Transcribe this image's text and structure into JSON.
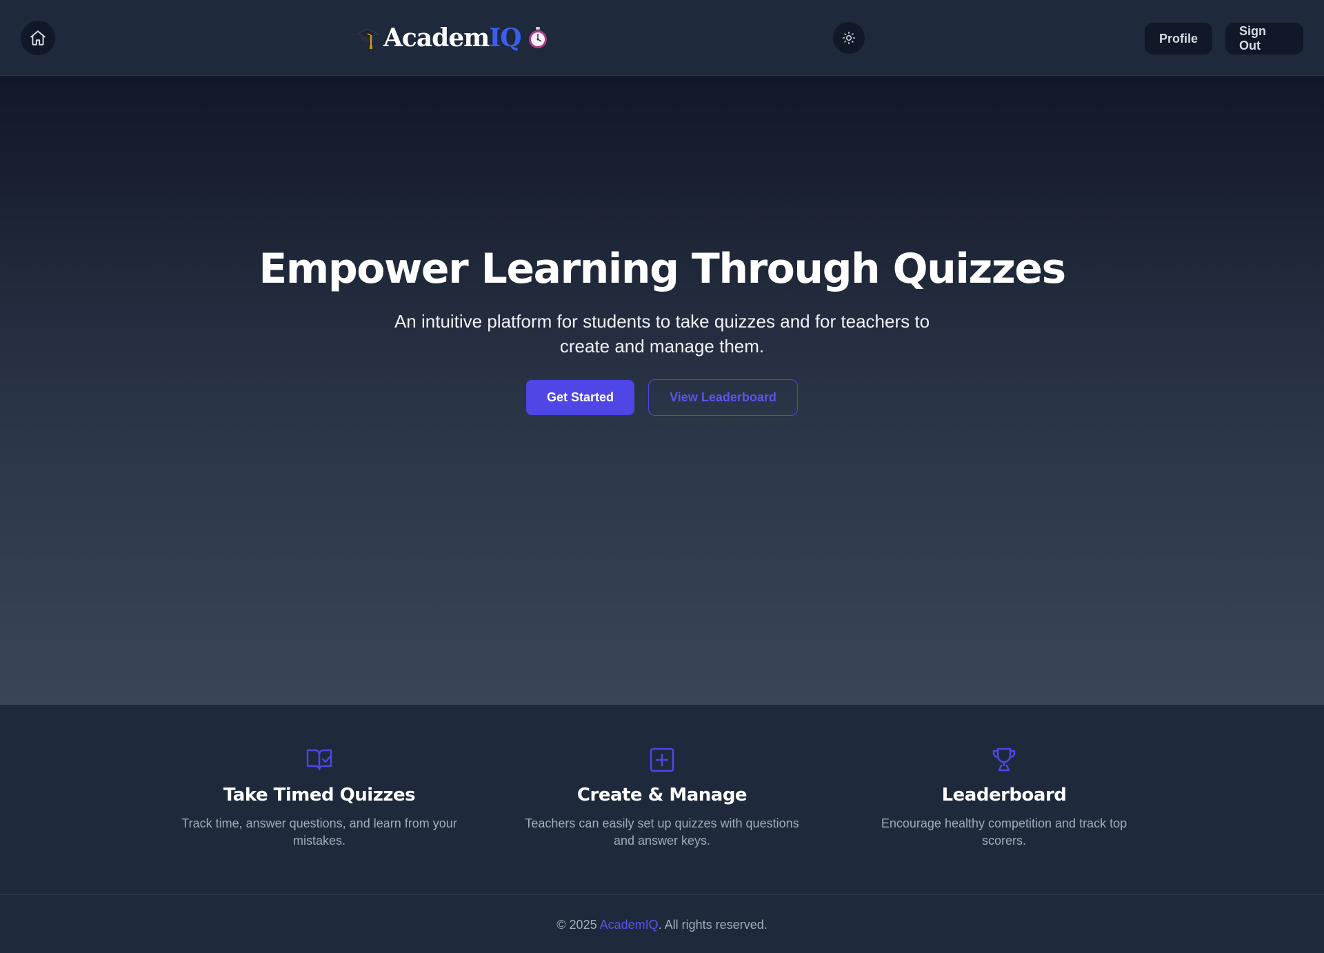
{
  "header": {
    "logo": {
      "text_main": "Academ",
      "text_accent": "IQ",
      "left_icon": "graduation-cap-icon",
      "right_icon": "stopwatch-icon"
    },
    "home_icon": "home-icon",
    "theme_icon": "sun-icon",
    "profile_label": "Profile",
    "signout_label": "Sign Out"
  },
  "hero": {
    "title": "Empower Learning Through Quizzes",
    "subtitle": "An intuitive platform for students to take quizzes and for teachers to create and manage them.",
    "primary_button": "Get Started",
    "secondary_button": "View Leaderboard"
  },
  "features": [
    {
      "icon": "book-check-icon",
      "title": "Take Timed Quizzes",
      "description": "Track time, answer questions, and learn from your mistakes."
    },
    {
      "icon": "plus-square-icon",
      "title": "Create & Manage",
      "description": "Teachers can easily set up quizzes with questions and answer keys."
    },
    {
      "icon": "trophy-icon",
      "title": "Leaderboard",
      "description": "Encourage healthy competition and track top scorers."
    }
  ],
  "footer": {
    "prefix": "© 2025 ",
    "brand": "AcademIQ",
    "suffix": ". All rights reserved."
  },
  "colors": {
    "accent": "#4f46e5",
    "logo_accent": "#3b5ef0",
    "background": "#1e293b",
    "hero_top": "#111827"
  }
}
